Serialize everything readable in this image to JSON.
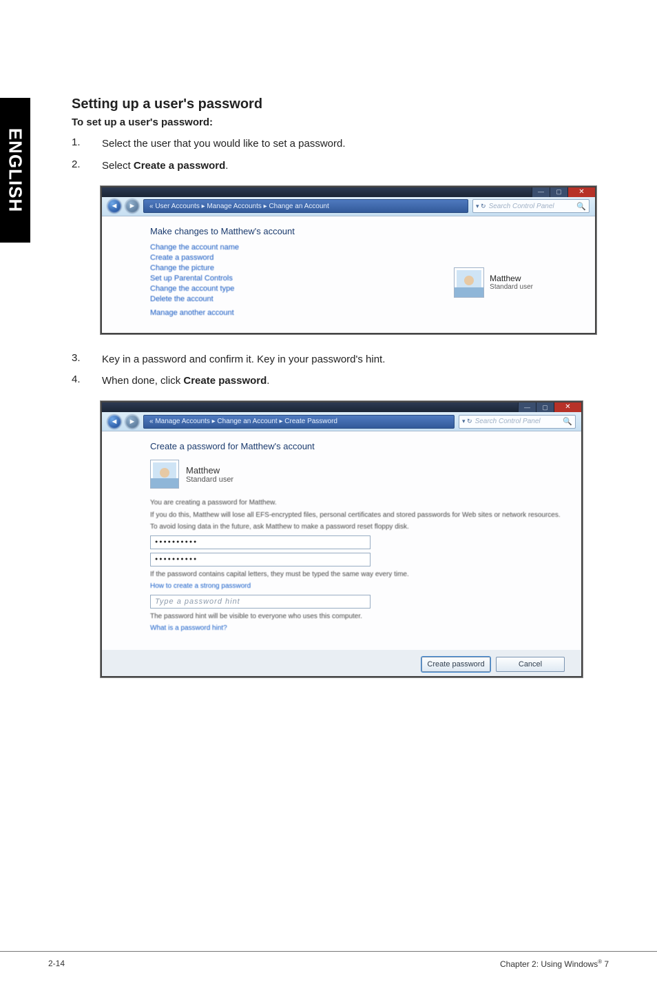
{
  "side_tab": "ENGLISH",
  "section": {
    "title": "Setting up a user's password",
    "subtitle": "To set up a user's password:"
  },
  "steps_a": [
    {
      "n": "1.",
      "html": "Select the user that you would like to set a password."
    },
    {
      "n": "2.",
      "html": "Select <b>Create a password</b>."
    }
  ],
  "steps_b": [
    {
      "n": "3.",
      "html": "Key in a password and confirm it. Key in your password's hint."
    },
    {
      "n": "4.",
      "html": "When done, click <b>Create password</b>."
    }
  ],
  "win1": {
    "breadcrumb": "« User Accounts ▸ Manage Accounts ▸ Change an Account",
    "search_placeholder": "Search Control Panel",
    "heading": "Make changes to Matthew's account",
    "links": [
      "Change the account name",
      "Create a password",
      "Change the picture",
      "Set up Parental Controls",
      "Change the account type",
      "Delete the account",
      "Manage another account"
    ],
    "account": {
      "name": "Matthew",
      "role": "Standard user"
    }
  },
  "win2": {
    "breadcrumb": "« Manage Accounts ▸ Change an Account ▸ Create Password",
    "search_placeholder": "Search Control Panel",
    "heading": "Create a password for Matthew's account",
    "user": {
      "name": "Matthew",
      "role": "Standard user"
    },
    "note1": "You are creating a password for Matthew.",
    "note2": "If you do this, Matthew will lose all EFS-encrypted files, personal certificates and stored passwords for Web sites or network resources.",
    "note3": "To avoid losing data in the future, ask Matthew to make a password reset floppy disk.",
    "caps_note": "If the password contains capital letters, they must be typed the same way every time.",
    "link_strong": "How to create a strong password",
    "hint_placeholder": "Type a password hint",
    "hint_note": "The password hint will be visible to everyone who uses this computer.",
    "link_hint": "What is a password hint?",
    "buttons": {
      "create": "Create password",
      "cancel": "Cancel"
    }
  },
  "footer": {
    "left": "2-14",
    "right_prefix": "Chapter 2: Using Windows",
    "right_suffix": " 7"
  }
}
